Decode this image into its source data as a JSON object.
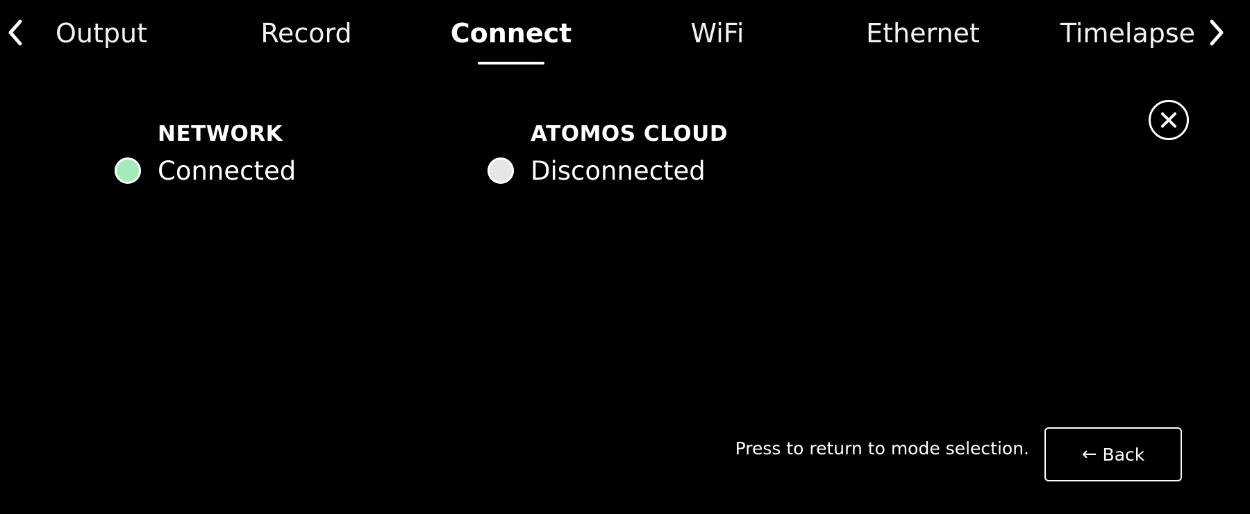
{
  "tabs": [
    {
      "label": "Output",
      "active": false
    },
    {
      "label": "Record",
      "active": false
    },
    {
      "label": "Connect",
      "active": true
    },
    {
      "label": "WiFi",
      "active": false
    },
    {
      "label": "Ethernet",
      "active": false
    },
    {
      "label": "Timelapse",
      "active": false
    }
  ],
  "nav": {
    "prev_icon": "chevron-left-icon",
    "next_icon": "chevron-right-icon"
  },
  "status": {
    "network": {
      "title": "NETWORK",
      "state": "Connected",
      "dot_color": "#a3ecb8"
    },
    "cloud": {
      "title": "ATOMOS CLOUD",
      "state": "Disconnected",
      "dot_color": "#e6e6e6"
    }
  },
  "close": {
    "icon": "close-icon"
  },
  "footer": {
    "hint": "Press to return to mode selection.",
    "back_arrow": "←",
    "back_label": "Back"
  },
  "colors": {
    "background": "#000000",
    "foreground": "#ffffff"
  }
}
